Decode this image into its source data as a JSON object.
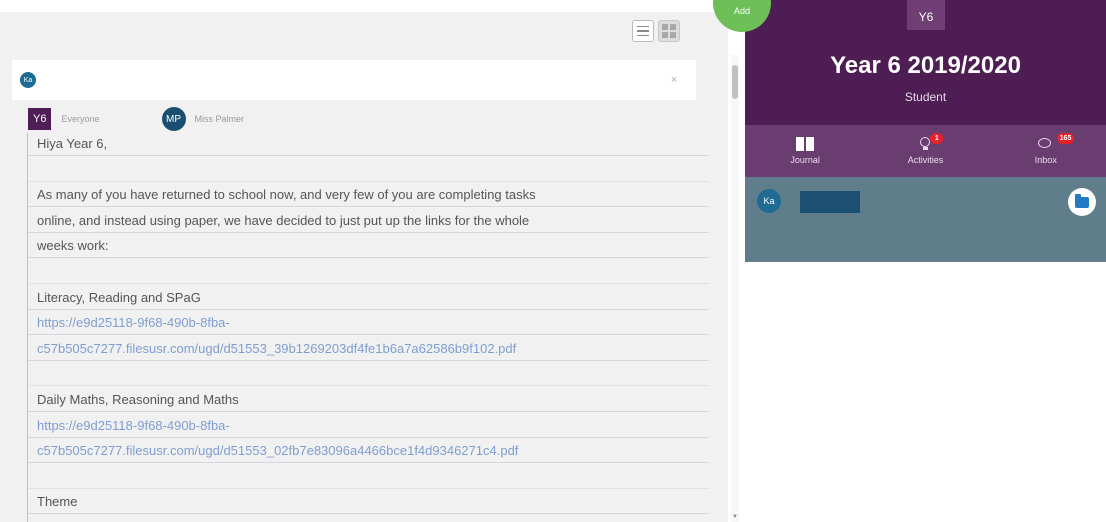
{
  "recipient": {
    "avatar": "Ka",
    "value": "",
    "placeholder": "",
    "clear_label": "×"
  },
  "post": {
    "class_badge": "Y6",
    "audience": "Everyone",
    "author_initials": "MP",
    "author_name": "Miss Palmer",
    "lines": [
      "Hiya Year 6,",
      "",
      "As many of you have returned to school now, and very few of you are completing tasks",
      "online, and instead using paper, we have decided to just put up the links for the whole",
      "weeks work:",
      "",
      "Literacy, Reading and SPaG",
      "https://e9d25118-9f68-490b-8fba-",
      "c57b505c7277.filesusr.com/ugd/d51553_39b1269203df4fe1b6a7a62586b9f102.pdf",
      "",
      "Daily Maths, Reasoning and Maths",
      "https://e9d25118-9f68-490b-8fba-",
      "c57b505c7277.filesusr.com/ugd/d51553_02fb7e83096a4466bce1f4d9346271c4.pdf",
      "",
      "Theme"
    ],
    "link_line_indices": [
      7,
      8,
      11,
      12
    ]
  },
  "fab": {
    "add_label": "Add"
  },
  "profile": {
    "class_code": "Y6",
    "title": "Year 6 2019/2020",
    "role": "Student"
  },
  "tabs": [
    {
      "label": "Journal",
      "icon": "journal-icon"
    },
    {
      "label": "Activities",
      "icon": "lightbulb-icon",
      "badge": "1"
    },
    {
      "label": "Inbox",
      "icon": "chat-icon",
      "badge": "165"
    }
  ],
  "student": {
    "avatar": "Ka",
    "name": ""
  },
  "colors": {
    "header_purple": "#4e1d54",
    "tab_purple": "#6a3d70",
    "student_bar": "#607d8b",
    "fab_green": "#6fbf58",
    "badge_red": "#e8202a",
    "link_blue": "#7f9ed0"
  }
}
